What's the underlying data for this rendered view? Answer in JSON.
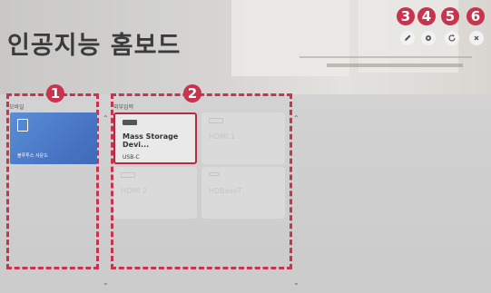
{
  "header": {
    "title": "인공지능 홈보드"
  },
  "toolbar": [
    {
      "icon": "pen-icon",
      "badge": "3"
    },
    {
      "icon": "gear-icon",
      "badge": "4"
    },
    {
      "icon": "refresh-icon",
      "badge": "5"
    },
    {
      "icon": "close-icon",
      "badge": "6"
    }
  ],
  "sections": {
    "mobile": {
      "label": "모바일",
      "badge": "1",
      "items": [
        {
          "name": "블루투스 사운드",
          "icon": "bluetooth-speaker-icon"
        }
      ]
    },
    "external": {
      "label": "외부입력",
      "badge": "2",
      "items": [
        {
          "name": "Mass Storage Devi...",
          "sub": "USB-C",
          "active": true
        },
        {
          "name": "HDMI 1",
          "sub": "",
          "active": false
        },
        {
          "name": "HDMI 2",
          "sub": "",
          "active": false
        },
        {
          "name": "HDBaseT",
          "sub": "",
          "active": false
        }
      ]
    }
  },
  "colors": {
    "accent": "#c8334d",
    "bluetooth_card": "#4a78c6"
  }
}
